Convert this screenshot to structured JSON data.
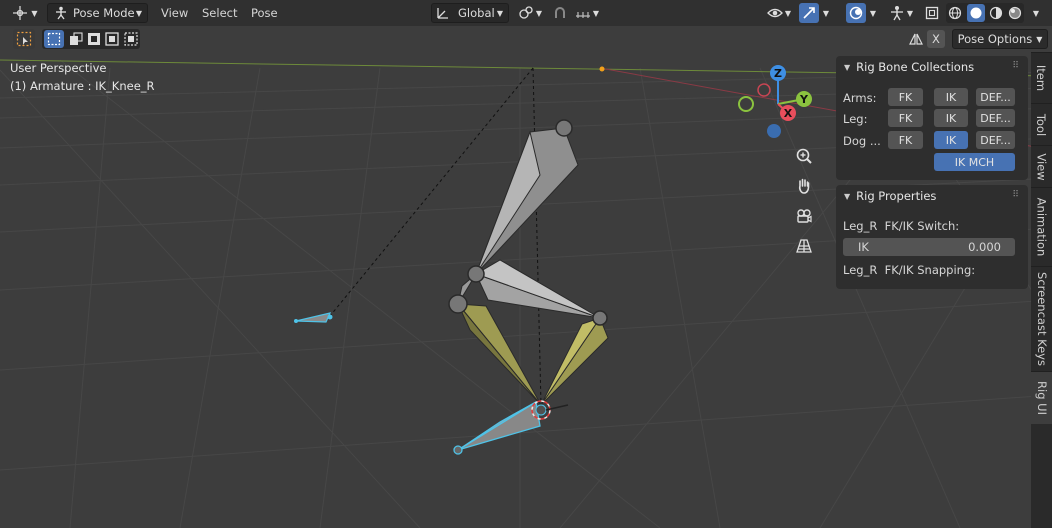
{
  "header": {
    "mode": "Pose Mode",
    "menus": [
      "View",
      "Select",
      "Pose"
    ],
    "transform_orientation": "Global"
  },
  "toolbar2": {
    "pose_options": "Pose Options",
    "x_label": "X"
  },
  "viewport": {
    "perspective": "User Perspective",
    "object_info": "(1) Armature : IK_Knee_R"
  },
  "gizmo": {
    "x": "X",
    "y": "Y",
    "z": "Z"
  },
  "rig_bone_collections": {
    "title": "Rig Bone Collections",
    "rows": [
      {
        "label": "Arms:",
        "fk": "FK",
        "ik": "IK",
        "def": "DEF..."
      },
      {
        "label": "Leg:",
        "fk": "FK",
        "ik": "IK",
        "def": "DEF..."
      },
      {
        "label": "Dog ...",
        "fk": "FK",
        "ik": "IK",
        "def": "DEF..."
      }
    ],
    "ik_mch": "IK MCH"
  },
  "rig_properties": {
    "title": "Rig Properties",
    "switch_label": "Leg_R  FK/IK Switch:",
    "field_name": "IK",
    "field_value": "0.000",
    "snapping_label": "Leg_R  FK/IK Snapping:"
  },
  "sidebar_tabs": [
    "Item",
    "Tool",
    "View",
    "Animation",
    "Screencast Keys",
    "Rig UI"
  ],
  "colors": {
    "accent": "#4772b3",
    "axis_x": "#e84e5c",
    "axis_y": "#8bc33f",
    "axis_z": "#3e8fe4",
    "selected_bone": "#4fc3e8",
    "bone_yellow": "#a9a552"
  }
}
